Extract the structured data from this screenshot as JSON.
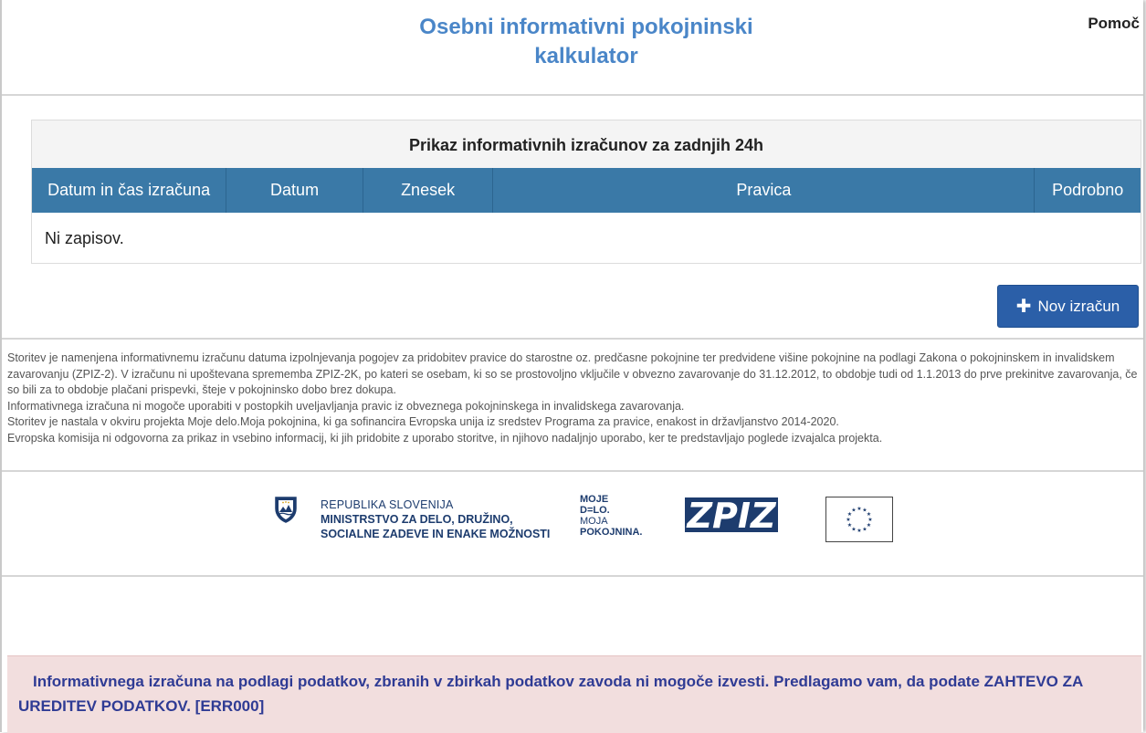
{
  "header": {
    "title_line1": "Osebni informativni pokojninski",
    "title_line2": "kalkulator",
    "help_label": "Pomoč"
  },
  "table": {
    "caption": "Prikaz informativnih izračunov za zadnjih 24h",
    "columns": [
      "Datum in čas izračuna",
      "Datum",
      "Znesek",
      "Pravica",
      "Podrobno"
    ],
    "empty_text": "Ni zapisov."
  },
  "new_button": {
    "icon": "plus-icon",
    "label": "Nov izračun"
  },
  "info": {
    "p1": "Storitev je namenjena informativnemu izračunu datuma izpolnjevanja pogojev za pridobitev pravice do starostne oz. predčasne pokojnine ter predvidene višine pokojnine na podlagi Zakona o pokojninskem in invalidskem zavarovanju (ZPIZ-2). V izračunu ni upoštevana sprememba ZPIZ-2K, po kateri se osebam, ki so se prostovoljno vključile v obvezno zavarovanje do 31.12.2012, to obdobje tudi od 1.1.2013 do prve prekinitve zavarovanja, če so bili za to obdobje plačani prispevki, šteje v pokojninsko dobo brez dokupa.",
    "p2": "Informativnega izračuna ni mogoče uporabiti v postopkih uveljavljanja pravic iz obveznega pokojninskega in invalidskega zavarovanja.",
    "p3": "Storitev je nastala v okviru projekta Moje delo.Moja pokojnina, ki ga sofinancira Evropska unija iz sredstev Programa za pravice, enakost in državljanstvo 2014-2020.",
    "p4": "Evropska komisija ni odgovorna za prikaz in vsebino informacij, ki jih pridobite z uporabo storitve, in njihovo nadaljnjo uporabo, ker te predstavljajo poglede izvajalca projekta."
  },
  "logos": {
    "ministry_line1": "REPUBLIKA SLOVENIJA",
    "ministry_line2": "MINISTRSTVO ZA DELO, DRUŽINO,",
    "ministry_line3": "SOCIALNE ZADEVE IN ENAKE MOŽNOSTI",
    "moje_line1": "MOJE",
    "moje_line2": "D=LO.",
    "moje_line3": "MOJA",
    "moje_line4": "POKOJNINA.",
    "zpiz_text": "ZPIZ"
  },
  "alert": {
    "text": "Informativnega izračuna na podlagi podatkov, zbranih v zbirkah podatkov zavoda ni mogoče izvesti. Predlagamo vam, da podate",
    "link_text": "ZAHTEVO ZA UREDITEV PODATKOV.",
    "code": "[ERR000]"
  },
  "colors": {
    "title": "#4a86c8",
    "table_header_bg": "#3a79a7",
    "button_bg": "#2b5fa8",
    "alert_bg": "#f2dede",
    "alert_text": "#2f3b94"
  }
}
